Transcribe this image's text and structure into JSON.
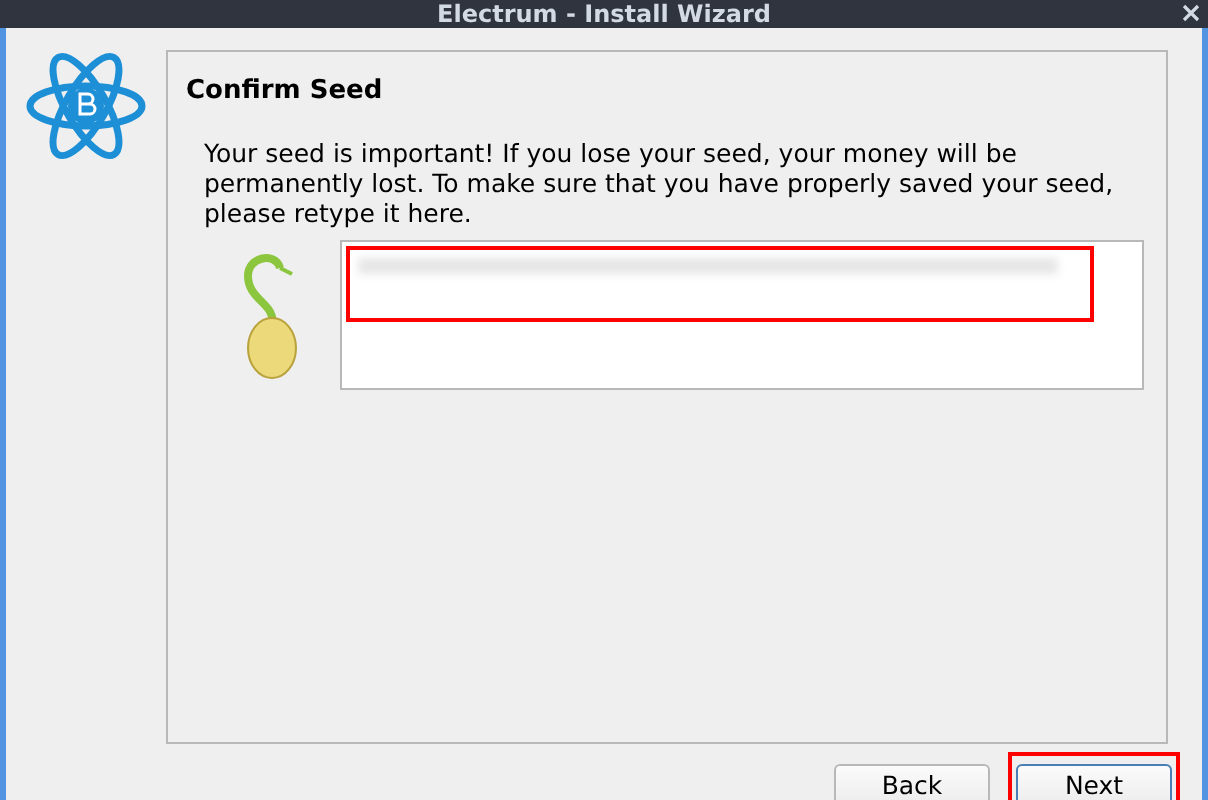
{
  "window": {
    "title": "Electrum  -  Install Wizard"
  },
  "page": {
    "heading": "Confirm Seed",
    "message": "Your seed is important! If you lose your seed, your money will be permanently lost. To make sure that you have properly saved your seed, please retype it here."
  },
  "buttons": [
    {
      "label": "Back",
      "highlighted": false
    },
    {
      "label": "Next",
      "highlighted": true
    }
  ]
}
